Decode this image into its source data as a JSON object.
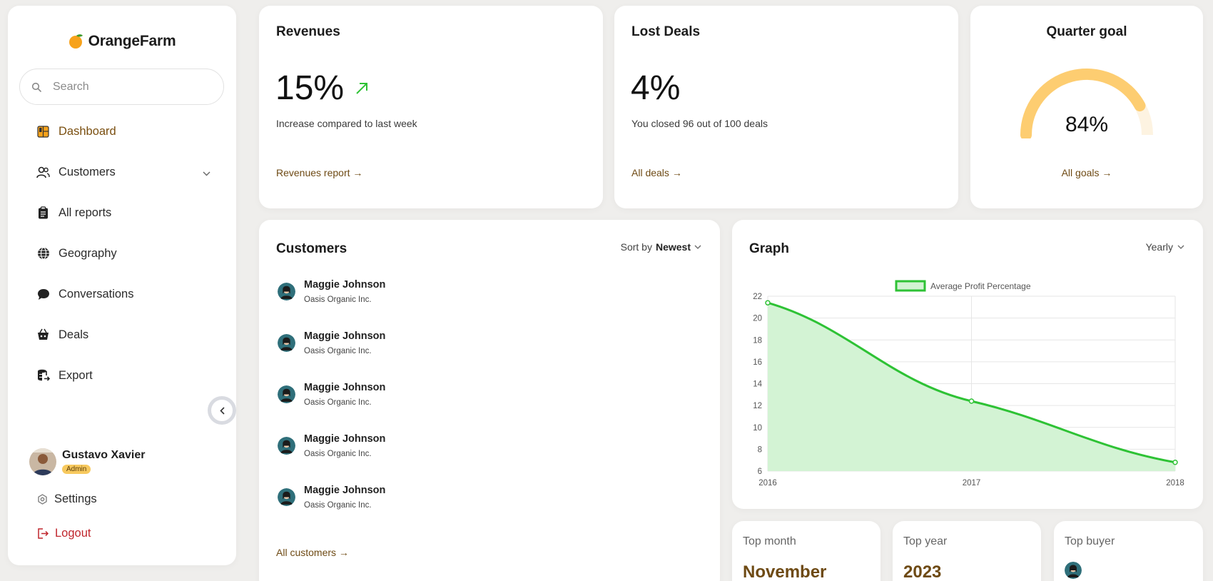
{
  "brand": {
    "name": "OrangeFarm",
    "accent": "#f7a21b"
  },
  "search": {
    "placeholder": "Search"
  },
  "nav": [
    {
      "label": "Dashboard",
      "icon": "dashboard-icon",
      "active": true
    },
    {
      "label": "Customers",
      "icon": "users-icon"
    },
    {
      "label": "All reports",
      "icon": "clipboard-icon"
    },
    {
      "label": "Geography",
      "icon": "globe-icon"
    },
    {
      "label": "Conversations",
      "icon": "chat-bubble-icon"
    },
    {
      "label": "Deals",
      "icon": "basket-icon"
    },
    {
      "label": "Export",
      "icon": "database-export-icon"
    }
  ],
  "user": {
    "name": "Gustavo Xavier",
    "role": "Admin"
  },
  "settings_label": "Settings",
  "logout_label": "Logout",
  "revenues": {
    "title": "Revenues",
    "value": "15%",
    "subtitle": "Increase compared to last week",
    "link": "Revenues report",
    "trend_color": "#2ec235"
  },
  "lost_deals": {
    "title": "Lost Deals",
    "value": "4%",
    "subtitle": "You closed 96 out of 100 deals",
    "link": "All deals"
  },
  "quarter_goal": {
    "title": "Quarter goal",
    "value": "84%",
    "progress": 0.84,
    "link": "All goals",
    "gauge_color": "#fdcd71",
    "gauge_track": "#fdf3e1"
  },
  "customers": {
    "title": "Customers",
    "sort_prefix": "Sort by",
    "sort_value": "Newest",
    "rows": [
      {
        "name": "Maggie Johnson",
        "company": "Oasis Organic Inc."
      },
      {
        "name": "Maggie Johnson",
        "company": "Oasis Organic Inc."
      },
      {
        "name": "Maggie Johnson",
        "company": "Oasis Organic Inc."
      },
      {
        "name": "Maggie Johnson",
        "company": "Oasis Organic Inc."
      },
      {
        "name": "Maggie Johnson",
        "company": "Oasis Organic Inc."
      }
    ],
    "link": "All customers"
  },
  "graph": {
    "title": "Graph",
    "period": "Yearly"
  },
  "chart_data": {
    "type": "area",
    "x": [
      "2016",
      "2017",
      "2018"
    ],
    "series": [
      {
        "name": "Average Profit Percentage",
        "values": [
          21.4,
          12.4,
          6.8
        ],
        "color": "#2ec235",
        "fill": "#d3f3d4"
      }
    ],
    "ylim": [
      6,
      22
    ],
    "yticks": [
      6,
      8,
      10,
      12,
      14,
      16,
      18,
      20,
      22
    ],
    "grid": true,
    "legend": "top-center"
  },
  "top_month": {
    "label": "Top month",
    "value": "November"
  },
  "top_year": {
    "label": "Top year",
    "value": "2023"
  },
  "top_buyer": {
    "label": "Top buyer"
  }
}
